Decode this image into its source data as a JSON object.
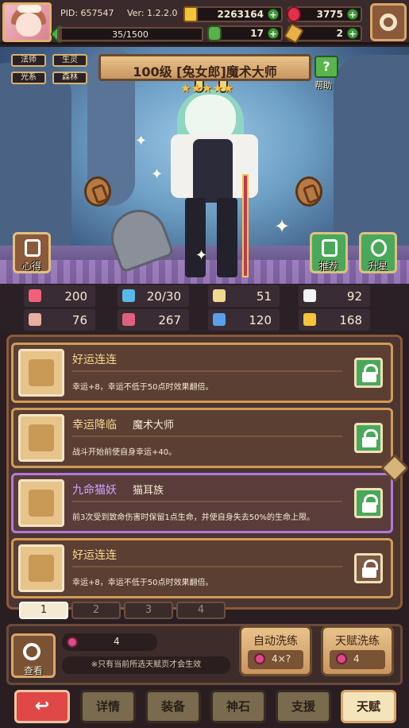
{
  "top": {
    "pid": "PID: 657547",
    "version": "Ver: 1.2.2.0",
    "gold": "2263164",
    "gems": "3775",
    "xp": "35/1500",
    "xp_fraction": 0.023,
    "clover": "17",
    "key": "2"
  },
  "hero": {
    "tags": [
      "法师",
      "生灵",
      "光系",
      "森林"
    ],
    "title": "100级  [兔女郎]魔术大师",
    "stars": 5,
    "help_label": "帮助",
    "left_button_label": "心得",
    "recommend_label": "推荐",
    "upgrade_label": "升星"
  },
  "attributes": [
    {
      "icon": "heart-icon",
      "value": "200",
      "color": "#f0607a"
    },
    {
      "icon": "water-drop-icon",
      "value": "20/30",
      "color": "#58b8e8"
    },
    {
      "icon": "shield-icon",
      "value": "51",
      "color": "#f0d890"
    },
    {
      "icon": "wing-icon",
      "value": "92",
      "color": "#f4f4f4"
    },
    {
      "icon": "fist-icon",
      "value": "76",
      "color": "#e8b0a0"
    },
    {
      "icon": "book-icon",
      "value": "267",
      "color": "#e06080"
    },
    {
      "icon": "scroll-icon",
      "value": "120",
      "color": "#5aa0e8"
    },
    {
      "icon": "horseshoe-icon",
      "value": "168",
      "color": "#f4c43a"
    }
  ],
  "talents": [
    {
      "name": "好运连连",
      "sub": "",
      "desc": "幸运+8，幸运不低于50点时效果翻倍。",
      "locked": true,
      "style": "gold"
    },
    {
      "name": "幸运降临",
      "sub": "魔术大师",
      "desc": "战斗开始前使自身幸运+40。",
      "locked": true,
      "style": "gold"
    },
    {
      "name": "九命猫妖",
      "sub": "猫耳族",
      "desc": "前3次受到致命伤害时保留1点生命，并使自身失去50%的生命上限。",
      "locked": true,
      "style": "purple"
    },
    {
      "name": "好运连连",
      "sub": "",
      "desc": "幸运+8，幸运不低于50点时效果翻倍。",
      "locked": false,
      "style": "gold"
    }
  ],
  "pages": [
    "1",
    "2",
    "3",
    "4"
  ],
  "bottom": {
    "view_label": "查看",
    "potion_count": "4",
    "note": "※只有当前所选天赋页才会生效",
    "auto_wash_label": "自动洗练",
    "auto_wash_cost": "4×?",
    "talent_wash_label": "天赋洗练",
    "talent_wash_cost": "4"
  },
  "nav": {
    "back": "↩",
    "items": [
      "详情",
      "装备",
      "神石",
      "支援",
      "天赋"
    ]
  }
}
